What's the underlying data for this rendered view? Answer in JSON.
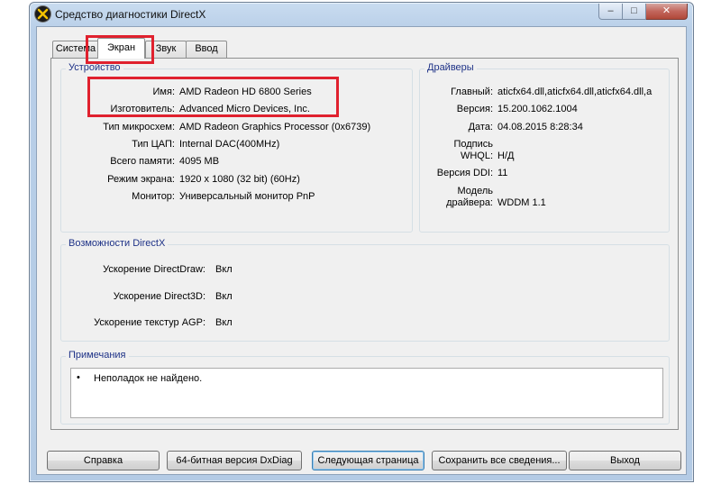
{
  "window": {
    "title": "Средство диагностики DirectX",
    "controls": {
      "minimize": "‒",
      "maximize": "□",
      "close": "✕"
    }
  },
  "tabs": [
    {
      "label": "Система",
      "active": false
    },
    {
      "label": "Экран",
      "active": true
    },
    {
      "label": "Звук",
      "active": false
    },
    {
      "label": "Ввод",
      "active": false
    }
  ],
  "device": {
    "title": "Устройство",
    "rows": [
      {
        "label": "Имя:",
        "value": "AMD Radeon HD 6800 Series"
      },
      {
        "label": "Изготовитель:",
        "value": "Advanced Micro Devices, Inc."
      },
      {
        "label": "Тип микросхем:",
        "value": "AMD Radeon Graphics Processor (0x6739)"
      },
      {
        "label": "Тип ЦАП:",
        "value": "Internal DAC(400MHz)"
      },
      {
        "label": "Всего памяти:",
        "value": "4095 MB"
      },
      {
        "label": "Режим экрана:",
        "value": "1920 x 1080 (32 bit) (60Hz)"
      },
      {
        "label": "Монитор:",
        "value": "Универсальный монитор PnP"
      }
    ]
  },
  "drivers": {
    "title": "Драйверы",
    "main_label": "Главный:",
    "main_value": "aticfx64.dll,aticfx64.dll,aticfx64.dll,a",
    "version_label": "Версия:",
    "version_value": "15.200.1062.1004",
    "date_label": "Дата:",
    "date_value": "04.08.2015 8:28:34",
    "whql_label_1": "Подпись",
    "whql_label_2": "WHQL:",
    "whql_value": "Н/Д",
    "ddi_label": "Версия DDI:",
    "ddi_value": "11",
    "model_label_1": "Модель",
    "model_label_2": "драйвера:",
    "model_value": "WDDM 1.1"
  },
  "directx": {
    "title": "Возможности DirectX",
    "rows": [
      {
        "label": "Ускорение DirectDraw:",
        "value": "Вкл"
      },
      {
        "label": "Ускорение Direct3D:",
        "value": "Вкл"
      },
      {
        "label": "Ускорение текстур AGP:",
        "value": "Вкл"
      }
    ]
  },
  "notes": {
    "title": "Примечания",
    "bullet": "•",
    "items": [
      "Неполадок не найдено."
    ]
  },
  "buttons": {
    "help": "Справка",
    "dxdiag64": "64-битная версия DxDiag",
    "next_page": "Следующая страница",
    "save_all": "Сохранить все сведения...",
    "exit": "Выход"
  },
  "colors": {
    "group_title": "#1e3287",
    "highlight": "#e0212e",
    "titlebar": "#b9cfe8"
  }
}
